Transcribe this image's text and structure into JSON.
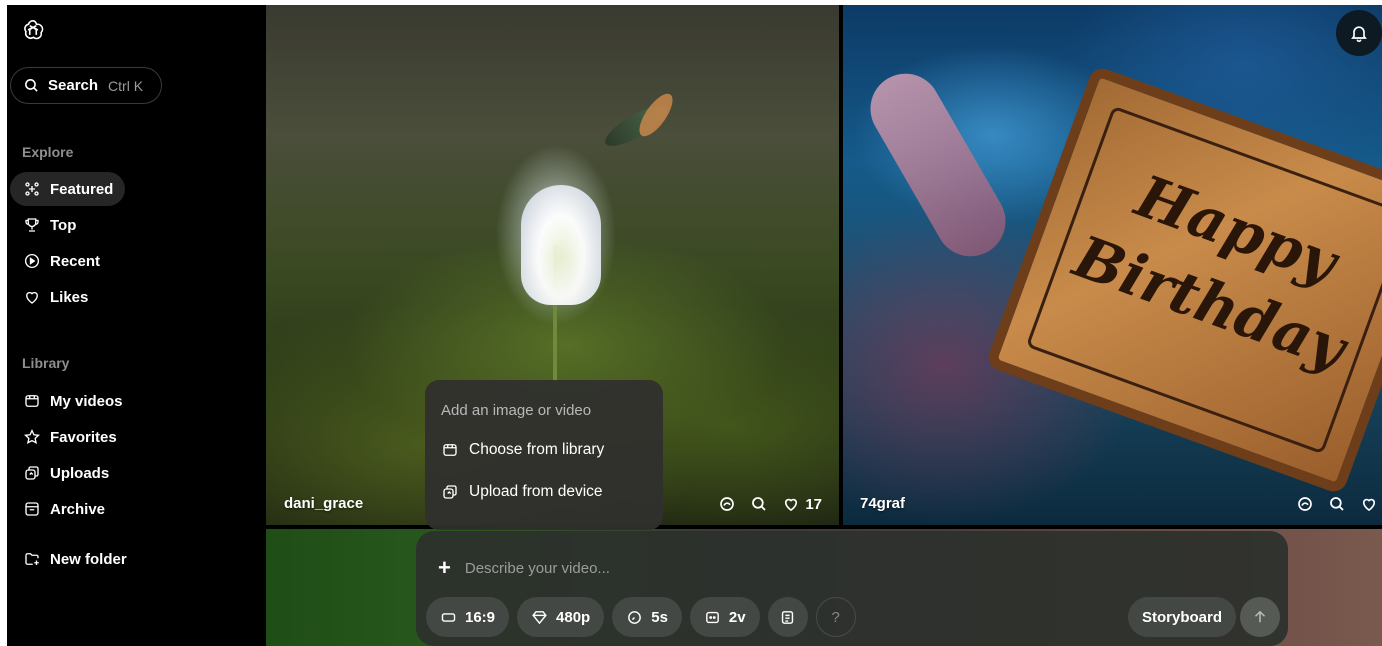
{
  "sidebar": {
    "search": {
      "label": "Search",
      "shortcut": "Ctrl K"
    },
    "explore_title": "Explore",
    "explore_items": [
      {
        "label": "Featured",
        "icon": "sparkle-icon",
        "active": true
      },
      {
        "label": "Top",
        "icon": "trophy-icon"
      },
      {
        "label": "Recent",
        "icon": "play-circle-icon"
      },
      {
        "label": "Likes",
        "icon": "heart-icon"
      }
    ],
    "library_title": "Library",
    "library_items": [
      {
        "label": "My videos",
        "icon": "video-library-icon"
      },
      {
        "label": "Favorites",
        "icon": "star-icon"
      },
      {
        "label": "Uploads",
        "icon": "uploads-icon"
      },
      {
        "label": "Archive",
        "icon": "archive-icon"
      }
    ],
    "new_folder": {
      "label": "New folder",
      "icon": "new-folder-icon"
    }
  },
  "gallery": {
    "tiles": [
      {
        "creator": "dani_grace",
        "likes": "17"
      },
      {
        "creator": "74graf",
        "likes": "",
        "sign_line1": "Happy",
        "sign_line2": "Birthday"
      }
    ]
  },
  "popup": {
    "title": "Add an image or video",
    "items": [
      {
        "label": "Choose from library",
        "icon": "library-icon"
      },
      {
        "label": "Upload from device",
        "icon": "upload-icon"
      }
    ]
  },
  "composer": {
    "placeholder": "Describe your video...",
    "chips": [
      {
        "label": "16:9",
        "icon": "aspect-ratio-icon"
      },
      {
        "label": "480p",
        "icon": "quality-icon"
      },
      {
        "label": "5s",
        "icon": "timer-icon"
      },
      {
        "label": "2v",
        "icon": "variations-icon"
      }
    ],
    "help_label": "?",
    "storyboard_label": "Storyboard"
  }
}
